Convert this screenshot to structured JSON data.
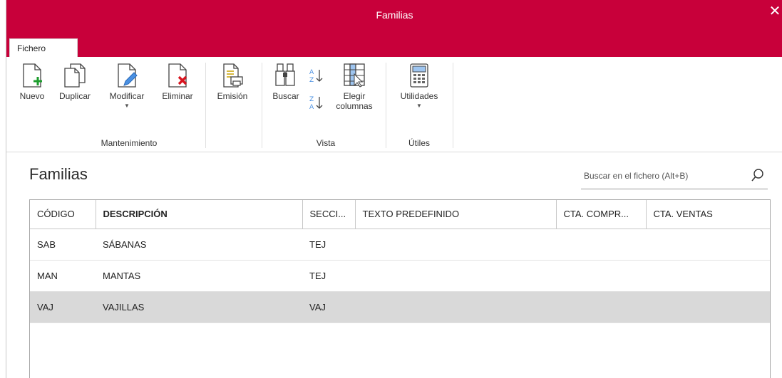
{
  "window": {
    "title": "Familias",
    "close_label": "✕"
  },
  "tabs": [
    {
      "label": "Fichero"
    }
  ],
  "ribbon": {
    "groups": {
      "mantenimiento": {
        "label": "Mantenimiento",
        "buttons": {
          "nuevo": "Nuevo",
          "duplicar": "Duplicar",
          "modificar": "Modificar",
          "eliminar": "Eliminar"
        }
      },
      "emision": {
        "button": "Emisión"
      },
      "vista": {
        "label": "Vista",
        "buttons": {
          "buscar": "Buscar",
          "elegir_columnas_1": "Elegir",
          "elegir_columnas_2": "columnas"
        }
      },
      "utiles": {
        "label": "Útiles",
        "buttons": {
          "utilidades": "Utilidades"
        }
      }
    },
    "caret": "▼"
  },
  "page": {
    "heading": "Familias"
  },
  "search": {
    "placeholder": "Buscar en el fichero (Alt+B)"
  },
  "table": {
    "columns": [
      "CÓDIGO",
      "DESCRIPCIÓN",
      "SECCI...",
      "TEXTO PREDEFINIDO",
      "CTA. COMPR...",
      "CTA. VENTAS"
    ],
    "rows": [
      {
        "codigo": "SAB",
        "descripcion": "SÁBANAS",
        "seccion": "TEJ",
        "texto": "",
        "cta_compras": "",
        "cta_ventas": ""
      },
      {
        "codigo": "MAN",
        "descripcion": "MANTAS",
        "seccion": "TEJ",
        "texto": "",
        "cta_compras": "",
        "cta_ventas": ""
      },
      {
        "codigo": "VAJ",
        "descripcion": "VAJILLAS",
        "seccion": "VAJ",
        "texto": "",
        "cta_compras": "",
        "cta_ventas": ""
      }
    ],
    "selected_row": 2
  },
  "colors": {
    "accent": "#c8003a",
    "selection": "#d9d9d9"
  }
}
